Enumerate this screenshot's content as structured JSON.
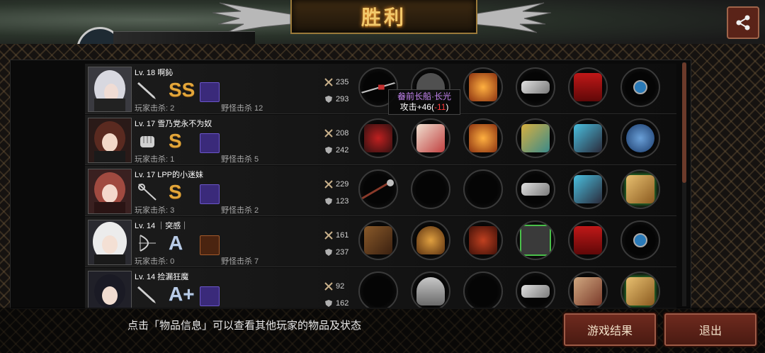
{
  "header": {
    "title": "胜利"
  },
  "tooltip": {
    "item_name": "畚前长船·长光",
    "stat_prefix": "攻击+46(",
    "stat_delta": "-11",
    "stat_suffix": ")"
  },
  "players": [
    {
      "lvname": "Lv. 18 啊鈊",
      "kills": "玩家击杀: 2",
      "monster": "野怪击杀 12",
      "rank": "SS",
      "atk": "235",
      "def": "293",
      "weapon_icon": "sword-icon",
      "pet_color": "#3a2a7a"
    },
    {
      "lvname": "Lv. 17 雪乃党永不为奴",
      "kills": "玩家击杀: 1",
      "monster": "野怪击杀 5",
      "rank": "S",
      "atk": "208",
      "def": "242",
      "weapon_icon": "fist-icon",
      "pet_color": "#3a2a7a"
    },
    {
      "lvname": "Lv. 17 LPP的小迷妹",
      "kills": "玩家击杀: 3",
      "monster": "野怪击杀 2",
      "rank": "S",
      "atk": "229",
      "def": "123",
      "weapon_icon": "rapier-icon",
      "pet_color": "#3a2a7a"
    },
    {
      "lvname": "Lv. 14 ｜突感｜",
      "kills": "玩家击杀: 0",
      "monster": "野怪击杀 7",
      "rank": "A",
      "atk": "161",
      "def": "237",
      "weapon_icon": "bow-icon",
      "pet_color": "#4a2410"
    },
    {
      "lvname": "Lv. 14 捡漏狂魔",
      "kills": "",
      "monster": "",
      "rank": "A+",
      "atk": "92",
      "def": "162",
      "weapon_icon": "sword-icon",
      "pet_color": "#3a2a7a"
    }
  ],
  "footer": {
    "hint": "点击「物品信息」可以查看其他玩家的物品及状态",
    "result_button": "游戏结果",
    "exit_button": "退出"
  },
  "colors": {
    "accent_gold": "#f2c86a",
    "rank_gold": "#e3a63a",
    "rank_blue": "#b9cbe6",
    "button_red": "#6e2a1e",
    "tooltip_purple": "#c484f0",
    "tooltip_red": "#ff3b3b"
  }
}
